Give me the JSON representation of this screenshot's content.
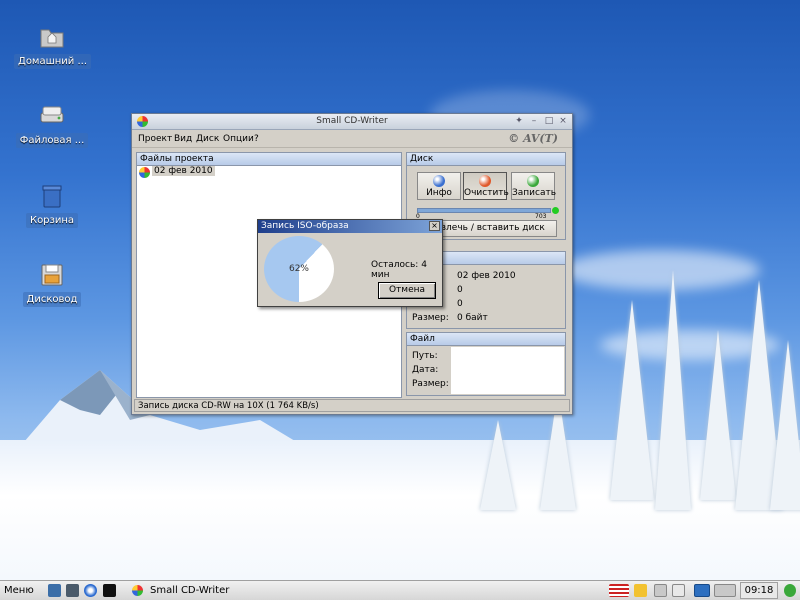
{
  "desktop": {
    "icons": [
      {
        "label": "Домашний ...",
        "icon": "home-folder-icon"
      },
      {
        "label": "Файловая ...",
        "icon": "hard-drive-icon"
      },
      {
        "label": "Корзина",
        "icon": "trash-icon"
      },
      {
        "label": "Дисковод",
        "icon": "floppy-drive-icon"
      }
    ]
  },
  "window": {
    "title": "Small CD-Writer",
    "brand": "© AV(T)",
    "menu": [
      "Проект",
      "Вид",
      "Диск",
      "Опции",
      "?"
    ],
    "files_panel": {
      "header": "Файлы проекта",
      "items": [
        "02 фев 2010"
      ]
    },
    "disc_group": {
      "header": "Диск",
      "buttons": [
        {
          "label": "Инфо",
          "color": "#3a6fd0"
        },
        {
          "label": "Очистить",
          "color": "#e0582a"
        },
        {
          "label": "Записать",
          "color": "#3aa83a"
        }
      ],
      "scale_min": "0",
      "scale_max": "703",
      "eject_label": "Извлечь / вставить диск"
    },
    "project_group": {
      "values": [
        "02 фев 2010",
        "0",
        "0"
      ],
      "size_label": "Размер:",
      "size_value": "0 байт"
    },
    "file_group": {
      "header": "Файл",
      "path_label": "Путь:",
      "date_label": "Дата:",
      "size_label": "Размер:"
    },
    "status_text": "Запись диска CD-RW на 10X (1 764 KB/s)"
  },
  "dialog": {
    "title": "Запись ISO-образа",
    "progress_percent": 62,
    "progress_text": "62%",
    "remaining_text": "Осталось: 4 мин",
    "cancel_label": "Отмена",
    "close_glyph": "×"
  },
  "taskbar": {
    "menu_label": "Меню",
    "task_title": "Small CD-Writer",
    "clock": "09:18"
  },
  "colors": {
    "pie_fill": "#a6c8f0",
    "pie_bg": "#ffffff",
    "progress": "#7fa7d8",
    "status_led": "#22cc22"
  }
}
